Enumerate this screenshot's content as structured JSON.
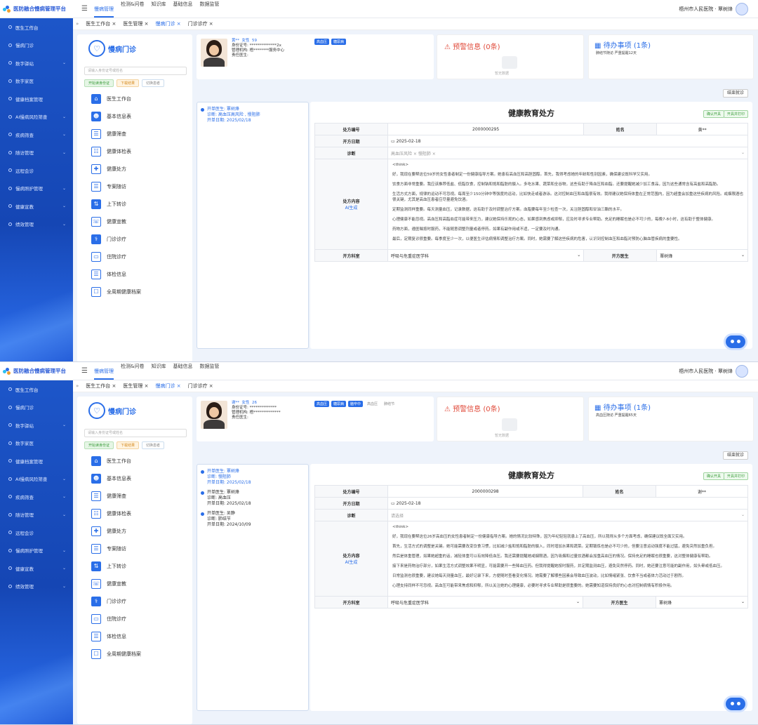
{
  "topbar": {
    "brand": "医防融合慢病管理平台",
    "nav": [
      "慢病管理",
      "检测&问卷",
      "知识库",
      "基础信息",
      "数据监管"
    ],
    "user": "梧州市人民医院 · 覃树烽"
  },
  "sidebar": [
    "医生工作台",
    "慢病门诊",
    "数字驿站",
    "数字家医",
    "健康档案管理",
    "AI慢病风险筛查",
    "疾病筛查",
    "随访管理",
    "远程会诊",
    "慢病照护管理",
    "健康宣教",
    "绩效管理"
  ],
  "tabs": [
    "医生工作台 ×",
    "医生管理 ×",
    "慢病门诊 ×",
    "门诊诊疗 ×"
  ],
  "left": {
    "title": "慢病门诊",
    "placeholder": "请输入身份证号或姓名",
    "btn1": "开始读身份证",
    "btn2": "下载结果",
    "btn3": "切换患者",
    "menu": [
      "医生工作台",
      "基本信息表",
      "健康筛查",
      "健康体检表",
      "健康处方",
      "专案随访",
      "上下转诊",
      "健康宣教",
      "门诊诊疗",
      "住院诊疗",
      "体检信息",
      "全周期健康档案"
    ]
  },
  "screens": [
    {
      "patient": {
        "name": "黄**",
        "gender": "女性",
        "age": "59",
        "id_label": "身份证号:",
        "id_value": "**************2x",
        "org_label": "管理机构:",
        "org_value": "梧********服务中心",
        "doc_label": "责任医生:",
        "tags": [
          "高血压",
          "糖尿病"
        ]
      },
      "warn": {
        "title": "预警信息 (0条)",
        "empty": "暂无数据"
      },
      "todo": {
        "title": "待办事项 (1条)",
        "sub": "肺结节随访 严重提醒12天"
      },
      "end": "结束就诊",
      "records": [
        {
          "doc": "开单医生: 覃树烽",
          "diag": "诊断: 高血压高风险 , 慢阻肺",
          "date": "开单日期: 2025/02/18"
        }
      ],
      "rx": {
        "title": "健康教育处方",
        "b1": "确认开具",
        "b2": "开具并打印",
        "no_label": "处方编号",
        "no": "2000000295",
        "name_label": "姓名",
        "name": "黄**",
        "date_label": "开方日期",
        "date": "2025-02-18",
        "diag_label": "诊断",
        "diag": "高血压风险 ×   慢阻肺 ×",
        "cont_label": "处方内容",
        "ai": "AI生成",
        "content": [
          "<think>",
          "好，我现在要帮这位59岁的女性患者制定一份健康指导方案。她患有高血压和高胆固醇。首先，我得考虑她的年龄和性别因素，确保建议既科学又实用。",
          "饮食方面非常重要。我应该推荐低盐、低脂饮食，控制钠和饱和脂肪的摄入。多吃水果、蔬菜和全谷物，这些有助于降血压和血脂。还要提醒她减少加工食品，因为这些通常含有高盐和高脂肪。",
          "生活方式方面，规律的运动不可忽视。每周至少150分钟中等强度的运动，比如快走或者游泳。这对控制血压和血脂很有效。我得建议她保持体重在正常范围内，因为超重会加重这些疾病的风险。戒烟限酒也很关键，尤其是高血压患者应尽量避免饮酒。",
          "定期监测同样重要。每天测量血压，记录数据，这有助于及时调整治疗方案。血脂要每年至少检查一次，关注胆固醇和甘油三酯的水平。",
          "心理健康不能忽视。高血压和高脂血症可能带来压力，建议她保持乐观的心态，如果感到焦虑或抑郁，应及时寻求专业帮助。充足的睡眠也是必不可少的，每晚7-8小时，这有助于整体健康。",
          "药物方面，遵医嘱按时服药，不能随意调整剂量或者停药。如果有副作用或不适，一定要及时沟通。",
          "最后，定期复诊很重要。每季度至少一次，以便医生评估病情和调整治疗方案。同时，她需要了解这些疾病的危害，认识到控制血压和血脂对预防心脑血管疾病的重要性。"
        ],
        "dept_label": "开方科室",
        "dept": "呼吸与危重症医学科",
        "doctor_label": "开方医生",
        "doctor": "覃树烽"
      }
    },
    {
      "patient": {
        "name": "谢**",
        "gender": "女性",
        "age": "26",
        "id_label": "身份证号:",
        "id_value": "**************",
        "org_label": "管理机构:",
        "org_value": "梧**************",
        "doc_label": "责任医生:",
        "tags": [
          "高血压",
          "糖尿病",
          "脑卒中",
          "高血压",
          "肺结节"
        ]
      },
      "warn": {
        "title": "预警信息 (0条)",
        "empty": "暂无数据"
      },
      "todo": {
        "title": "待办事项 (1条)",
        "sub": "高血压随访 严重提醒65天"
      },
      "end": "结束就诊",
      "records": [
        {
          "doc": "开单医生: 覃树烽",
          "diag": "诊断: 慢阻肺",
          "date": "开单日期: 2025/02/18"
        },
        {
          "doc": "开单医生: 覃树烽",
          "diag": "诊断: 高血压",
          "date": "开单日期: 2025/02/18"
        },
        {
          "doc": "开单医生: 吴静",
          "diag": "诊断: 肺结节",
          "date": "开单日期: 2024/10/09"
        }
      ],
      "rx": {
        "title": "健康教育处方",
        "b1": "确认开具",
        "b2": "开具并打印",
        "no_label": "处方编号",
        "no": "2000000298",
        "name_label": "姓名",
        "name": "谢**",
        "date_label": "开方日期",
        "date": "2025-02-18",
        "diag_label": "诊断",
        "diag": "请选择",
        "cont_label": "处方内容",
        "ai": "AI生成",
        "content": [
          "<think>",
          "好，我现在要帮这位26岁高血压的女性患者制定一份健康指导方案。她的情况比较特殊，因为年纪轻轻就患上了高血压，所以我得从多个方面考虑，确保建议既全面又实用。",
          "首先，生活方式的调整是关键。她可能需要改变饮食习惯，比如减少盐和饱和脂肪的摄入，同时增加水果和蔬菜。定期锻炼也是必不可少的，但要注意运动强度不能过猛，避免突然加重负担。",
          "然后是体重管理，如果她超重的话，减轻体重可以有效降低血压。我还需要提醒她戒烟限酒，因为吸烟和过量饮酒都会加重高血压的情况。保持充足的睡眠也很重要，这对整体健康有帮助。",
          "接下来是药物治疗部分，如果生活方式调整效果不明显，可能需要开一些降血压药。但我得提醒她按时服药，并定期监测血压，避免突然停药。同时，她还要注意可能的副作用，如头晕或低血压。",
          "日常监测也很重要，建议她每天测量血压，最好记录下来，方便随时查看变化情况。她需要了解哪些因素会导致血压波动，比如情绪紧张、饮食不当或者体力活动过于剧烈。",
          "心理支持同样不可忽视。高血压可能带来焦虑和抑郁，所以关注她的心理健康，必要时寻求专业帮助是很重要的。她需要知道保持良好的心态对控制病情有积极作用。"
        ],
        "dept_label": "开方科室",
        "dept": "呼吸与危重症医学科",
        "doctor_label": "开方医生",
        "doctor": "覃树烽"
      }
    }
  ]
}
